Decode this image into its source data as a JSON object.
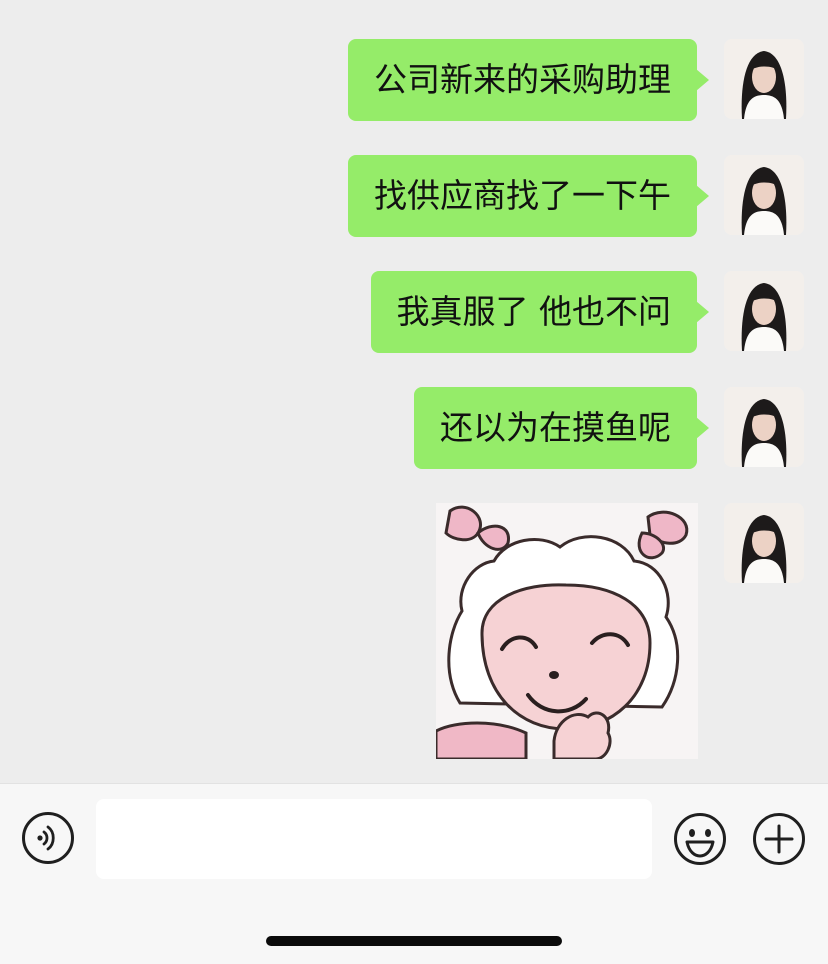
{
  "messages": [
    {
      "sender": "me",
      "text": "公司新来的采购助理"
    },
    {
      "sender": "me",
      "text": "找供应商找了一下午"
    },
    {
      "sender": "me",
      "text": "我真服了 他也不问"
    },
    {
      "sender": "me",
      "text": "还以为在摸鱼呢"
    },
    {
      "sender": "me",
      "type": "sticker",
      "sticker": "pink-bow-lamb-cartoon-smiling"
    }
  ],
  "input_bar": {
    "text_value": "",
    "placeholder": "",
    "left_icon": "voice-icon",
    "right_icons": [
      "emoji-icon",
      "plus-icon"
    ]
  },
  "colors": {
    "chat_background": "#ededed",
    "bubble_outgoing": "#95ec69",
    "input_bar_background": "#f7f7f7"
  }
}
